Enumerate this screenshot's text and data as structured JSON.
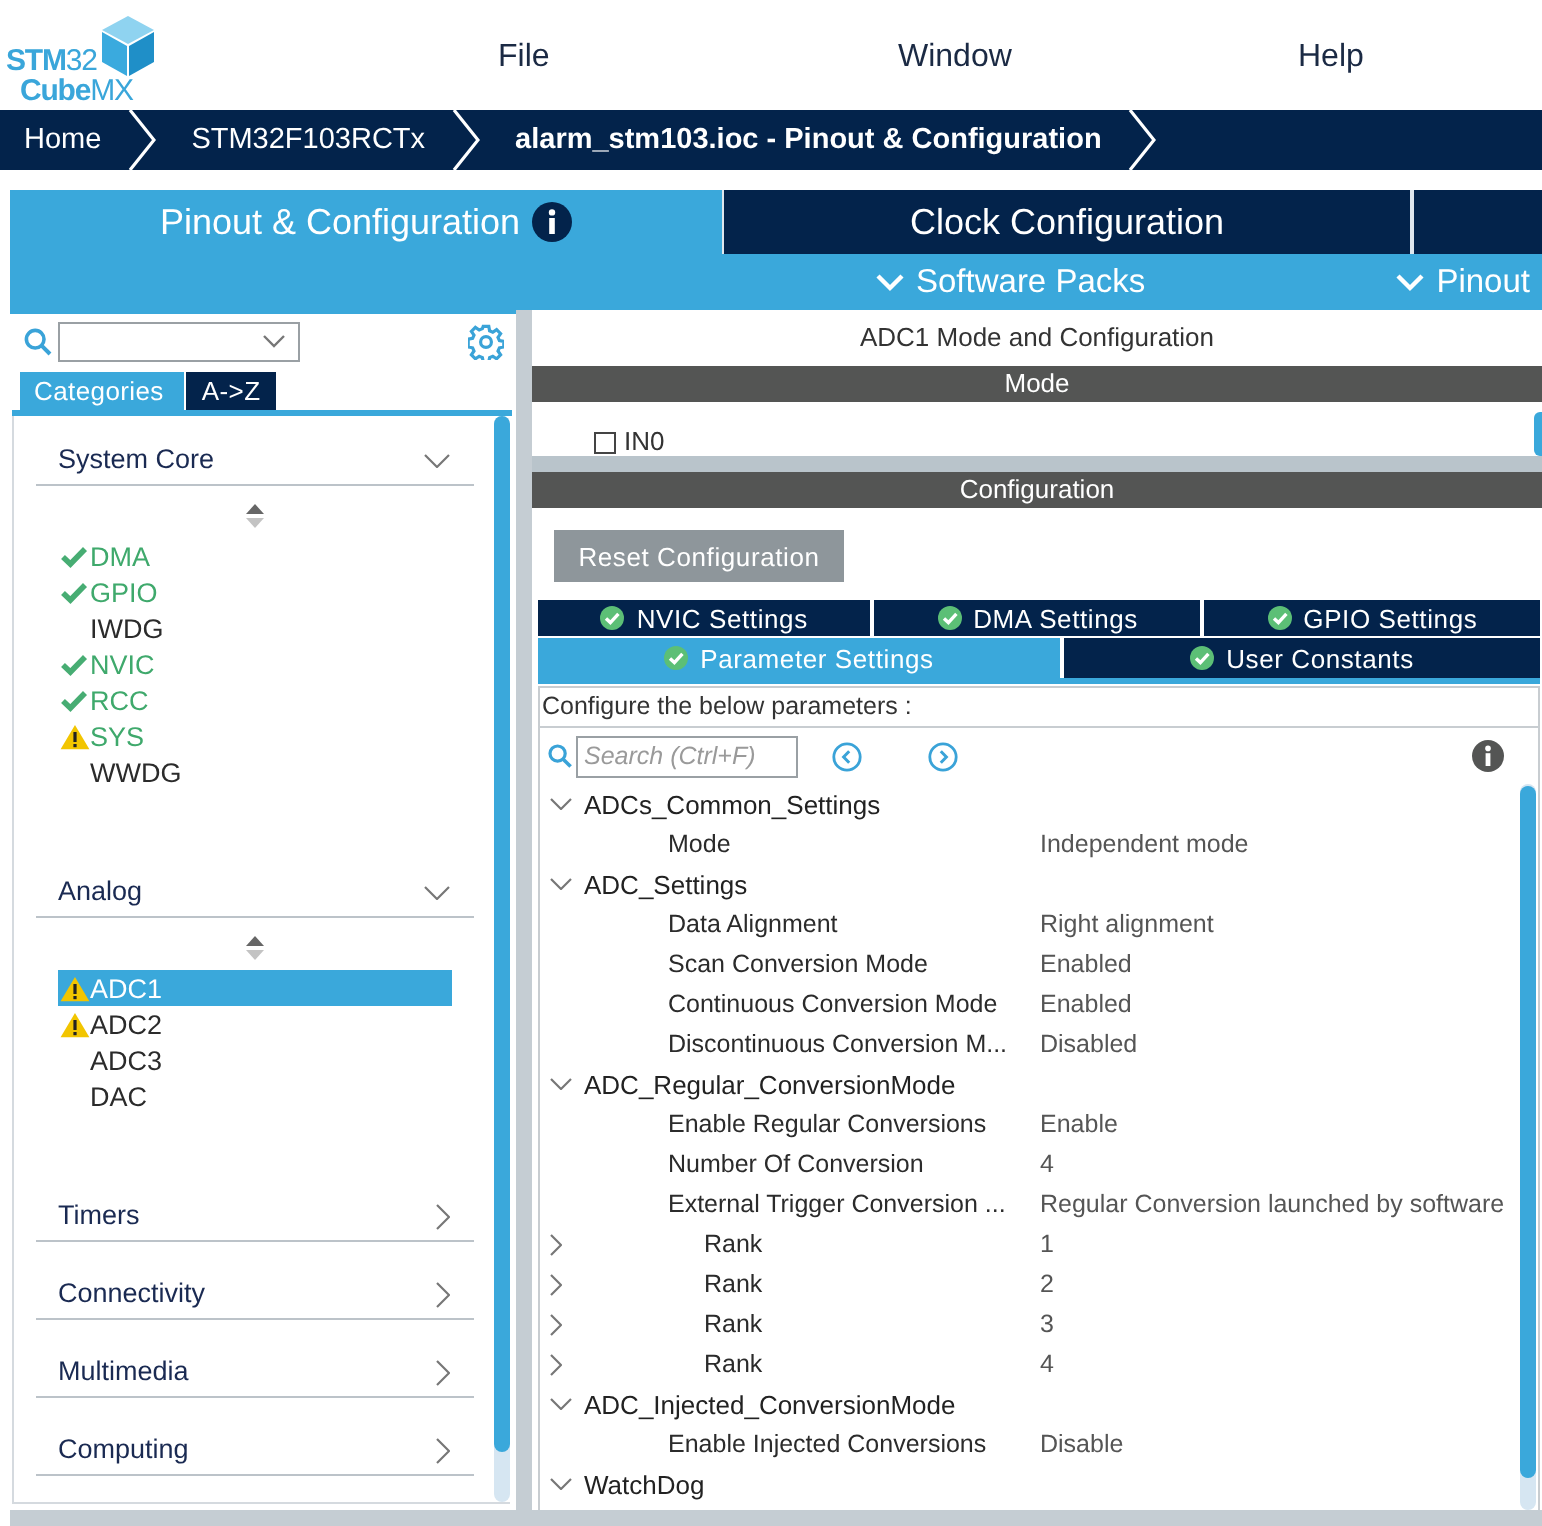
{
  "header": {
    "logo": {
      "line_1": "**STM**32",
      "line_2": "**Cube**MX"
    },
    "menu": [
      "File",
      "Window",
      "Help"
    ]
  },
  "breadcrumb": [
    {
      "label": "Home",
      "current": false
    },
    {
      "label": "STM32F103RCTx",
      "current": false
    },
    {
      "label": "alarm_stm103.ioc - Pinout & Configuration",
      "current": true
    }
  ],
  "main_tabs": [
    {
      "label": "Pinout & Configuration",
      "selected": true,
      "info_icon": true
    },
    {
      "label": "Clock Configuration",
      "selected": false,
      "info_icon": false
    }
  ],
  "sub_menus": [
    "Software Packs",
    "Pinout"
  ],
  "left_panel": {
    "view_tabs": [
      {
        "label": "Categories",
        "selected": true
      },
      {
        "label": "A->Z",
        "selected": false
      }
    ],
    "categories": [
      {
        "label": "System Core",
        "expanded": true,
        "items": [
          {
            "label": "DMA",
            "kind": "configured",
            "enabled": true,
            "selected": false
          },
          {
            "label": "GPIO",
            "kind": "configured",
            "enabled": true,
            "selected": false
          },
          {
            "label": "IWDG",
            "kind": "plain",
            "enabled": false,
            "selected": false
          },
          {
            "label": "NVIC",
            "kind": "configured",
            "enabled": true,
            "selected": false
          },
          {
            "label": "RCC",
            "kind": "configured",
            "enabled": true,
            "selected": false
          },
          {
            "label": "SYS",
            "kind": "warning",
            "enabled": true,
            "selected": false
          },
          {
            "label": "WWDG",
            "kind": "plain",
            "enabled": false,
            "selected": false
          }
        ]
      },
      {
        "label": "Analog",
        "expanded": true,
        "items": [
          {
            "label": "ADC1",
            "kind": "warning",
            "enabled": false,
            "selected": true
          },
          {
            "label": "ADC2",
            "kind": "warning",
            "enabled": false,
            "selected": false
          },
          {
            "label": "ADC3",
            "kind": "plain",
            "enabled": false,
            "selected": false
          },
          {
            "label": "DAC",
            "kind": "plain",
            "enabled": false,
            "selected": false
          }
        ]
      },
      {
        "label": "Timers",
        "expanded": false
      },
      {
        "label": "Connectivity",
        "expanded": false
      },
      {
        "label": "Multimedia",
        "expanded": false
      },
      {
        "label": "Computing",
        "expanded": false
      }
    ]
  },
  "right_panel": {
    "title": "ADC1 Mode and Configuration",
    "mode": {
      "header": "Mode",
      "channels": [
        {
          "label": "IN0",
          "checked": false
        }
      ]
    },
    "configuration": {
      "header": "Configuration",
      "reset_button": "Reset Configuration",
      "tab_rows": [
        [
          {
            "label": "NVIC Settings",
            "valid": true,
            "selected": false
          },
          {
            "label": "DMA Settings",
            "valid": true,
            "selected": false
          },
          {
            "label": "GPIO Settings",
            "valid": true,
            "selected": false
          }
        ],
        [
          {
            "label": "Parameter Settings",
            "valid": true,
            "selected": true
          },
          {
            "label": "User Constants",
            "valid": true,
            "selected": false
          }
        ]
      ],
      "hint": "Configure the below parameters :",
      "search": {
        "placeholder": "Search (Ctrl+F)"
      },
      "groups": [
        {
          "label": "ADCs_Common_Settings",
          "expanded": true,
          "children": [
            {
              "kind": "setting",
              "label": "Mode",
              "value": "Independent mode"
            }
          ]
        },
        {
          "label": "ADC_Settings",
          "expanded": true,
          "children": [
            {
              "kind": "setting",
              "label": "Data Alignment",
              "value": "Right alignment"
            },
            {
              "kind": "setting",
              "label": "Scan Conversion Mode",
              "value": "Enabled"
            },
            {
              "kind": "setting",
              "label": "Continuous Conversion Mode",
              "value": "Enabled"
            },
            {
              "kind": "setting",
              "label": "Discontinuous Conversion M...",
              "value": "Disabled"
            }
          ]
        },
        {
          "label": "ADC_Regular_ConversionMode",
          "expanded": true,
          "children": [
            {
              "kind": "setting",
              "label": "Enable Regular Conversions",
              "value": "Enable"
            },
            {
              "kind": "setting",
              "label": "Number Of Conversion",
              "value": "4"
            },
            {
              "kind": "setting",
              "label": "External Trigger Conversion ...",
              "value": "Regular Conversion launched by software"
            },
            {
              "kind": "subgroup",
              "label": "Rank",
              "value": "1",
              "expanded": false
            },
            {
              "kind": "subgroup",
              "label": "Rank",
              "value": "2",
              "expanded": false
            },
            {
              "kind": "subgroup",
              "label": "Rank",
              "value": "3",
              "expanded": false
            },
            {
              "kind": "subgroup",
              "label": "Rank",
              "value": "4",
              "expanded": false
            }
          ]
        },
        {
          "label": "ADC_Injected_ConversionMode",
          "expanded": true,
          "children": [
            {
              "kind": "setting",
              "label": "Enable Injected Conversions",
              "value": "Disable"
            }
          ]
        },
        {
          "label": "WatchDog",
          "expanded": true
        }
      ]
    }
  }
}
